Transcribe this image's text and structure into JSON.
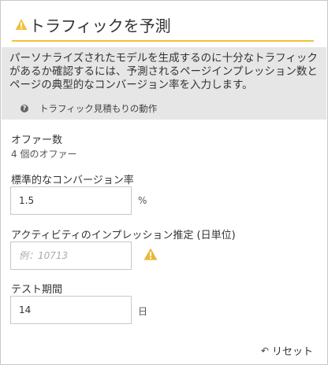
{
  "header": {
    "title": "トラフィックを予測",
    "icon": "warning-icon",
    "accent_color": "#f0c23b"
  },
  "info": {
    "description": "パーソナライズされたモデルを生成するのに十分なトラフィックがあるか確認するには、予測されるページインプレッション数とページの典型的なコンバージョン率を入力します。",
    "help_icon": "question-icon",
    "help_link": "トラフィック見積もりの動作"
  },
  "offers": {
    "label": "オファー数",
    "value": "4 個のオファー"
  },
  "conversion": {
    "label": "標準的なコンバージョン率",
    "value": "1.5",
    "unit": "%"
  },
  "impressions": {
    "label": "アクティビティのインプレッション推定 (日単位)",
    "placeholder": "例：10713",
    "value": "",
    "warning_icon": "warning-icon"
  },
  "duration": {
    "label": "テスト期間",
    "value": "14",
    "unit": "日"
  },
  "footer": {
    "reset_label": "リセット",
    "reset_icon": "undo-icon"
  }
}
